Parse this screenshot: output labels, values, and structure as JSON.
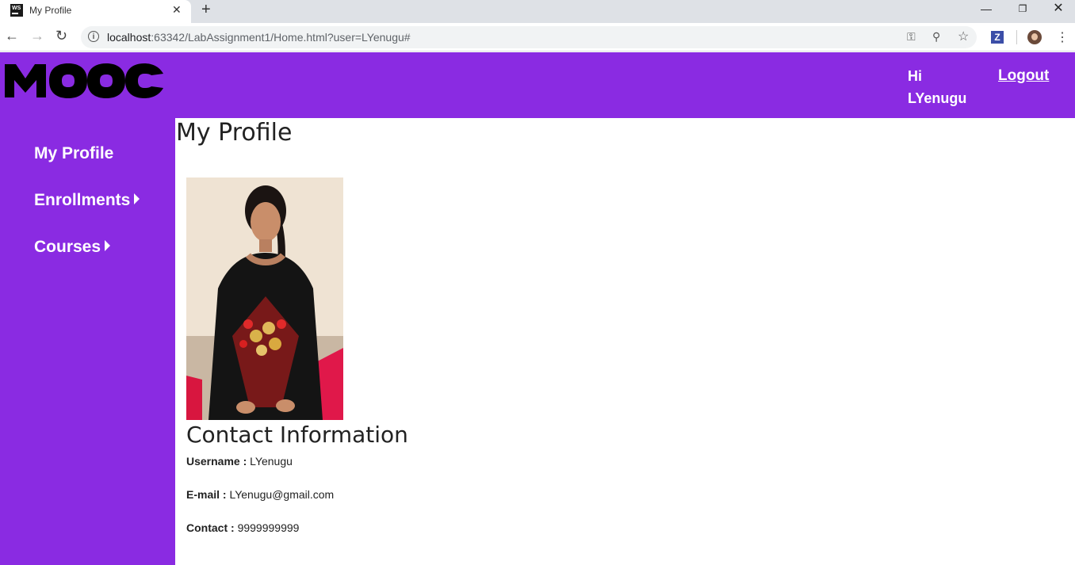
{
  "browser": {
    "tab_title": "My Profile",
    "favicon_text": "WS",
    "url_host": "localhost",
    "url_rest": ":63342/LabAssignment1/Home.html?user=LYenugu#",
    "extension_label": "Z"
  },
  "header": {
    "logo_text": "MOOC",
    "greeting_line1": "Hi",
    "greeting_line2": "LYenugu",
    "logout_label": "Logout",
    "brand_color": "#8a2be2"
  },
  "sidebar": {
    "items": [
      {
        "label": "My Profile",
        "has_caret": false
      },
      {
        "label": "Enrollments",
        "has_caret": true
      },
      {
        "label": "Courses",
        "has_caret": true
      }
    ]
  },
  "main": {
    "title": "My Profile",
    "contact_title": "Contact Information",
    "fields": [
      {
        "label": "Username :",
        "value": "LYenugu"
      },
      {
        "label": "E-mail :",
        "value": "LYenugu@gmail.com"
      },
      {
        "label": "Contact :",
        "value": "9999999999"
      }
    ]
  }
}
